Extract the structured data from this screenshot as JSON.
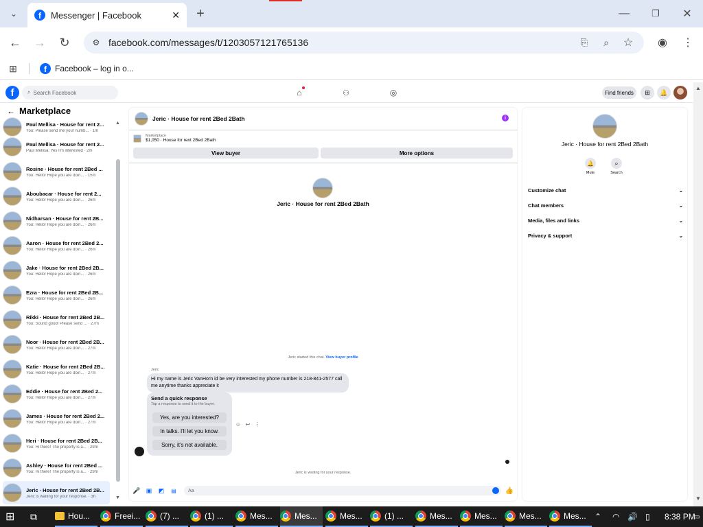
{
  "browser": {
    "tab_title": "Messenger | Facebook",
    "url": "facebook.com/messages/t/1203057121765136",
    "bookmark": "Facebook – log in o..."
  },
  "fbnav": {
    "search_placeholder": "Search Facebook",
    "find_friends": "Find friends"
  },
  "sidebar": {
    "title": "Marketplace",
    "items": [
      {
        "name": "Paul Mellisa · House for rent 2...",
        "preview": "You: Please send me your numb... · 1m"
      },
      {
        "name": "Paul Mellisa · House for rent 2...",
        "preview": "Paul Mellisa: Yes I'm interested · 2m"
      },
      {
        "name": "Rosine · House for rent 2Bed ...",
        "preview": "You: Hello! Hope you are doin... · 15m"
      },
      {
        "name": "Aboubacar · House for rent 2...",
        "preview": "You: Hello! Hope you are doin... · 26m"
      },
      {
        "name": "Nidharsan · House for rent 2B...",
        "preview": "You: Hello! Hope you are doin... · 26m"
      },
      {
        "name": "Aaron · House for rent 2Bed 2...",
        "preview": "You: Hello! Hope you are doin... · 26m"
      },
      {
        "name": "Jake · House for rent 2Bed 2B...",
        "preview": "You: Hello! Hope you are doin... · 26m"
      },
      {
        "name": "Ezra · House for rent 2Bed 2B...",
        "preview": "You: Hello! Hope you are doin... · 26m"
      },
      {
        "name": "Rikki · House for rent 2Bed 2B...",
        "preview": "You: Sound good! Please send ... · 27m"
      },
      {
        "name": "Noor · House for rent 2Bed 2B...",
        "preview": "You: Hello! Hope you are doin... · 27m"
      },
      {
        "name": "Katie · House for rent 2Bed 2B...",
        "preview": "You: Hello! Hope you are doin... · 27m"
      },
      {
        "name": "Eddie · House for rent 2Bed 2...",
        "preview": "You: Hello! Hope you are doin... · 27m"
      },
      {
        "name": "James · House for rent 2Bed 2...",
        "preview": "You: Hello! Hope you are doin... · 27m"
      },
      {
        "name": "Heri · House for rent 2Bed 2B...",
        "preview": "You: Hi there! The property is a... · 29m"
      },
      {
        "name": "Ashley · House for rent 2Bed ...",
        "preview": "You: Hi there! The property is a... · 29m"
      },
      {
        "name": "Jeric · House for rent 2Bed 2B...",
        "preview": "Jeric is waiting for your response. · 3h"
      }
    ]
  },
  "chat": {
    "title": "Jeric · House for rent 2Bed 2Bath",
    "listing_label": "Marketplace",
    "listing_price": "$1,050 · House for rent 2Bed 2Bath",
    "view_buyer": "View buyer",
    "more_options": "More options",
    "intro_name": "Jeric · House for rent 2Bed 2Bath",
    "started_text": "Jeric started this chat.",
    "view_profile": "View buyer profile",
    "sender": "Jeric",
    "message": "Hi my name is Jeric VanHorn id be very interested my phone number is 218-841-2577 call me anytime thanks appreciate it",
    "quick_title": "Send a quick response",
    "quick_sub": "Tap a response to send it to the buyer.",
    "quick_replies": [
      "Yes, are you interested?",
      "In talks. I'll let you know.",
      "Sorry, it's not available."
    ],
    "waiting": "Jeric is waiting for your response.",
    "input_placeholder": "Aa"
  },
  "info": {
    "name": "Jeric · House for rent 2Bed 2Bath",
    "mute": "Mute",
    "search": "Search",
    "sections": [
      "Customize chat",
      "Chat members",
      "Media, files and links",
      "Privacy & support"
    ]
  },
  "taskbar": {
    "items": [
      "Hou...",
      "Freei...",
      "(7) ...",
      "(1) ...",
      "Mes...",
      "Mes...",
      "Mes...",
      "(1) ...",
      "Mes...",
      "Mes...",
      "Mes...",
      "Mes..."
    ],
    "time": "8:38 PM"
  },
  "colors": {
    "fb_blue": "#0866ff",
    "info_purple": "#a033ff"
  }
}
